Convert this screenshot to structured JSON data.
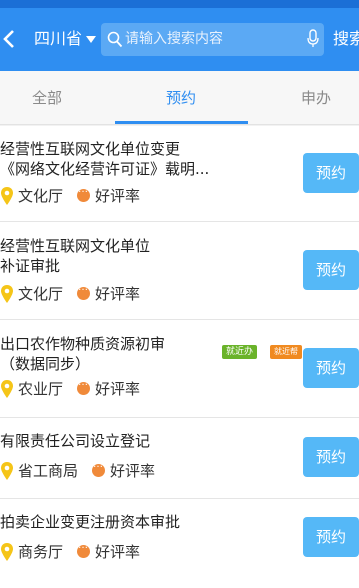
{
  "header": {
    "region": "四川省",
    "search_placeholder": "请输入搜索内容",
    "search_button": "搜索"
  },
  "tabs": [
    {
      "label": "全部",
      "active": false
    },
    {
      "label": "预约",
      "active": true
    },
    {
      "label": "申办",
      "active": false
    }
  ],
  "items": [
    {
      "title_line1": "经营性互联网文化单位变更",
      "title_line2": "《网络文化经营许可证》载明...",
      "department": "文化厅",
      "rating_label": "好评率",
      "action": "预约"
    },
    {
      "title_line1": "经营性互联网文化单位",
      "title_line2": "补证审批",
      "department": "文化厅",
      "rating_label": "好评率",
      "action": "预约"
    },
    {
      "title_line1": "出口农作物种质资源初审",
      "title_line2": "（数据同步）",
      "department": "农业厅",
      "rating_label": "好评率",
      "action": "预约",
      "tags": [
        "就近办",
        "就近帮"
      ]
    },
    {
      "title_line1": "有限责任公司设立登记",
      "department": "省工商局",
      "rating_label": "好评率",
      "action": "预约"
    },
    {
      "title_line1": "拍卖企业变更注册资本审批",
      "department": "商务厅",
      "rating_label": "好评率",
      "action": "预约"
    }
  ],
  "colors": {
    "primary": "#2f8ef1",
    "button": "#55b8f7",
    "pin": "#f5c518",
    "rating_dot": "#f08a3a",
    "tag_green": "#6ab32a",
    "tag_orange": "#f08a20"
  }
}
